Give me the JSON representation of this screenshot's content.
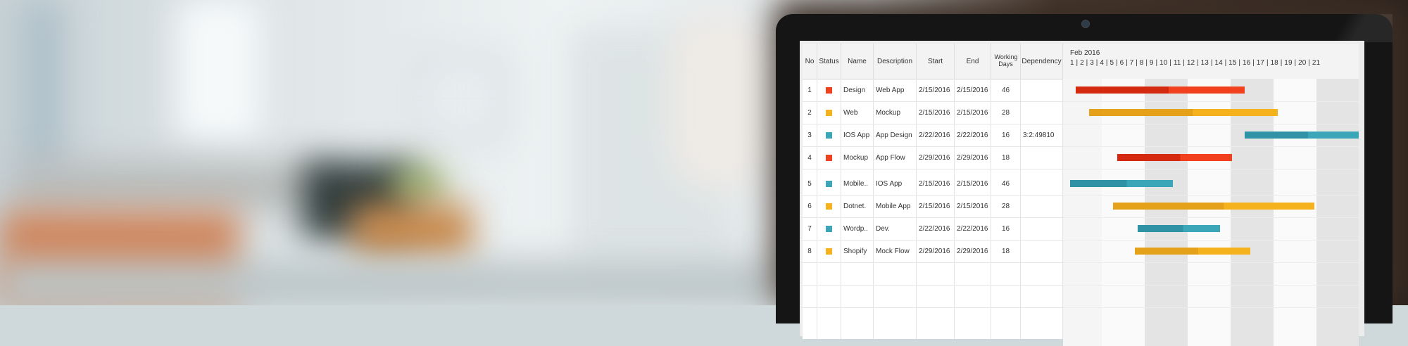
{
  "chart_data": {
    "type": "gantt",
    "month_label": "Feb 2016",
    "day_scale": "1 | 2 | 3 | 4 | 5 | 6 | 7 | 8 | 9 | 10 | 11 | 12 | 13 | 14 | 15 | 16 | 17 | 18 | 19 | 20 | 21",
    "colors": {
      "red": "#f0401e",
      "yellow": "#f6b21c",
      "blue": "#3aa6b8"
    }
  },
  "columns": {
    "no": "No",
    "status": "Status",
    "name": "Name",
    "description": "Description",
    "start": "Start",
    "end": "End",
    "working_days": "Working Days",
    "dependency": "Dependency"
  },
  "rows": [
    {
      "no": "1",
      "color": "#f0401e",
      "name": "Design",
      "description": "Web App",
      "start": "2/15/2016",
      "end": "2/15/2016",
      "working_days": "46",
      "dependency": "",
      "bar_start": 1.4,
      "bar_end": 13.2,
      "bar_color": "red"
    },
    {
      "no": "2",
      "color": "#f6b21c",
      "name": "Web",
      "description": "Mockup",
      "start": "2/15/2016",
      "end": "2/15/2016",
      "working_days": "28",
      "dependency": "",
      "bar_start": 2.3,
      "bar_end": 15.5,
      "bar_color": "yellow"
    },
    {
      "no": "3",
      "color": "#3aa6b8",
      "name": "IOS App",
      "description": "App Design",
      "start": "2/22/2016",
      "end": "2/22/2016",
      "working_days": "16",
      "dependency": "3:2:49810",
      "bar_start": 13.2,
      "bar_end": 21.3,
      "bar_color": "blue"
    },
    {
      "no": "4",
      "color": "#f0401e",
      "name": "Mockup",
      "description": "App Flow",
      "start": "2/29/2016",
      "end": "2/29/2016",
      "working_days": "18",
      "dependency": "",
      "bar_start": 4.3,
      "bar_end": 12.3,
      "bar_color": "red"
    },
    {
      "no": "5",
      "color": "#3aa6b8",
      "name": "Mobile..",
      "description": "IOS App",
      "start": "2/15/2016",
      "end": "2/15/2016",
      "working_days": "46",
      "dependency": "",
      "bar_start": 1.0,
      "bar_end": 8.2,
      "bar_color": "blue"
    },
    {
      "no": "6",
      "color": "#f6b21c",
      "name": "Dotnet.",
      "description": "Mobile App",
      "start": "2/15/2016",
      "end": "2/15/2016",
      "working_days": "28",
      "dependency": "",
      "bar_start": 4.0,
      "bar_end": 18.1,
      "bar_color": "yellow"
    },
    {
      "no": "7",
      "color": "#3aa6b8",
      "name": "Wordp..",
      "description": "Dev.",
      "start": "2/22/2016",
      "end": "2/22/2016",
      "working_days": "16",
      "dependency": "",
      "bar_start": 5.7,
      "bar_end": 11.5,
      "bar_color": "blue"
    },
    {
      "no": "8",
      "color": "#f6b21c",
      "name": "Shopify",
      "description": "Mock Flow",
      "start": "2/29/2016",
      "end": "2/29/2016",
      "working_days": "18",
      "dependency": "",
      "bar_start": 5.5,
      "bar_end": 13.6,
      "bar_color": "yellow"
    }
  ]
}
